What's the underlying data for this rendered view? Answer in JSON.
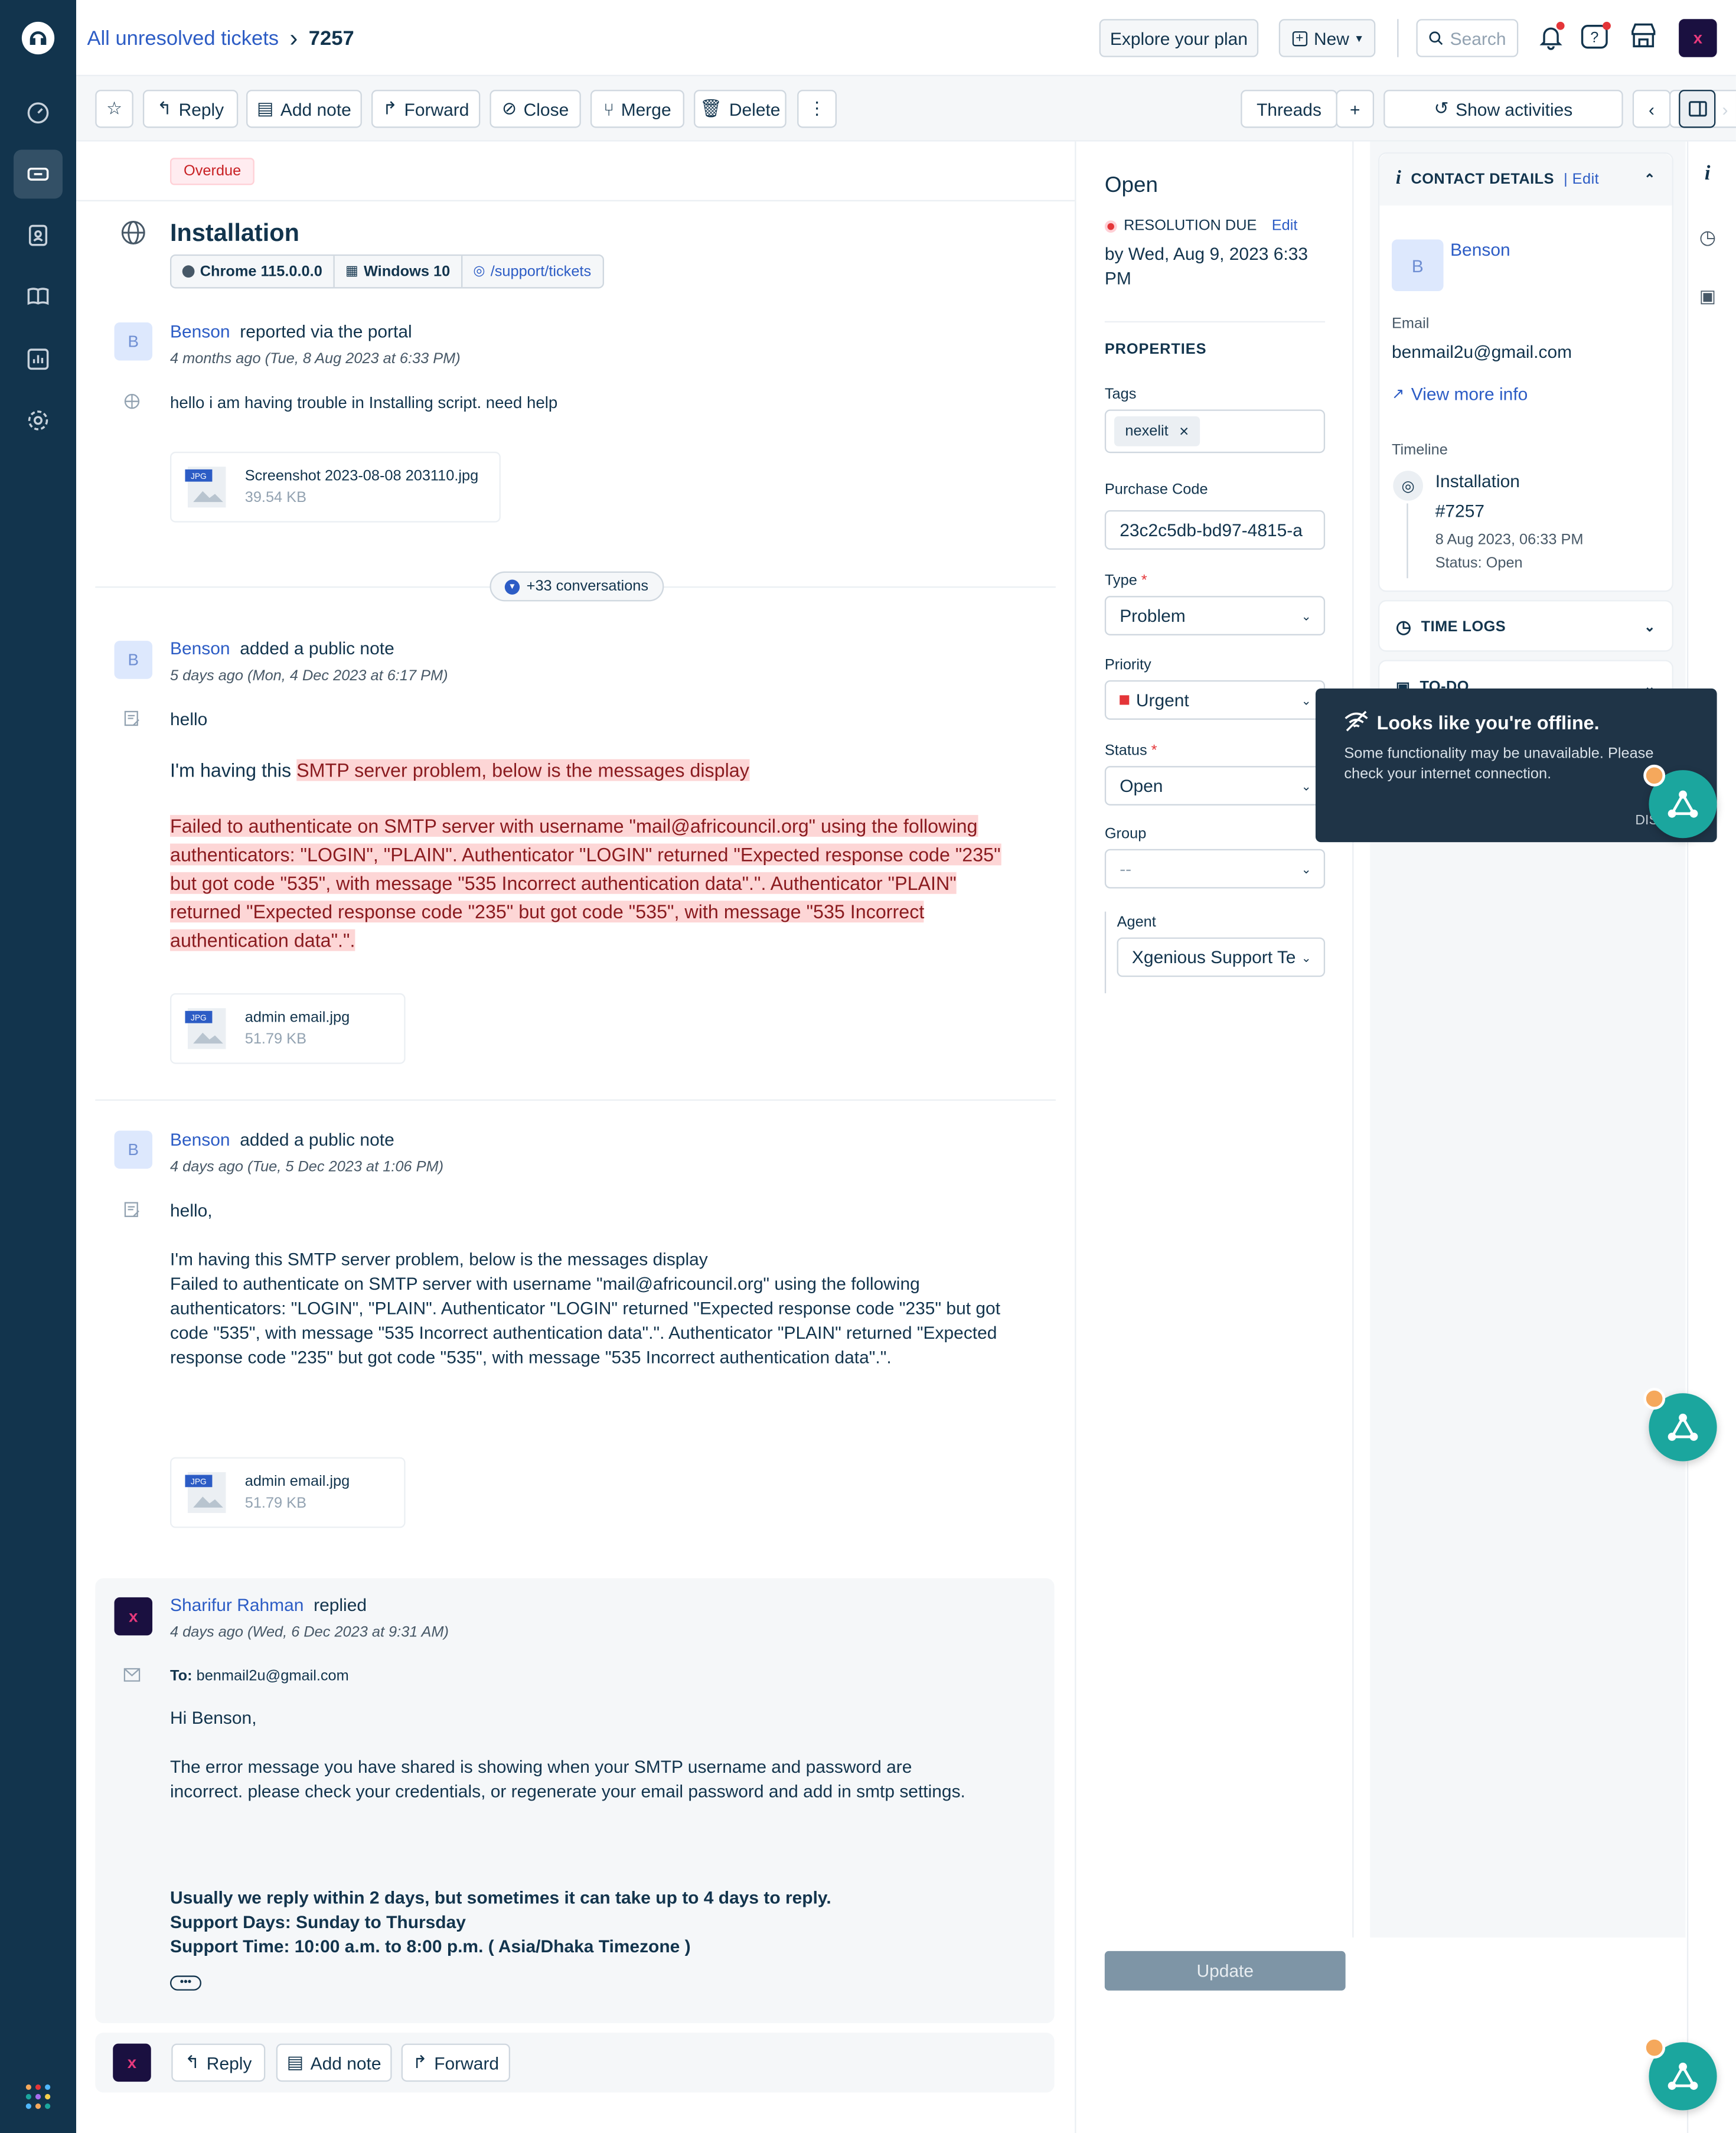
{
  "header": {
    "breadcrumb_parent": "All unresolved tickets",
    "breadcrumb_sep": "›",
    "ticket_id": "7257",
    "explore_plan": "Explore your plan",
    "new_label": "New",
    "search_placeholder": "Search"
  },
  "toolbar": {
    "reply": "Reply",
    "add_note": "Add note",
    "forward": "Forward",
    "close": "Close",
    "merge": "Merge",
    "delete": "Delete",
    "more": "⋮",
    "threads": "Threads",
    "plus": "+",
    "show_activities": "Show activities",
    "prev": "‹",
    "ellipsis": "···",
    "next": "›"
  },
  "ticket": {
    "overdue": "Overdue",
    "subject": "Installation",
    "browser": "Chrome 115.0.0.0",
    "os": "Windows 10",
    "url": "/support/tickets",
    "more_conversations": "+33 conversations"
  },
  "messages": [
    {
      "author": "Benson",
      "action": "reported via the portal",
      "time": "4 months ago (Tue, 8 Aug 2023 at 6:33 PM)",
      "body": "hello i am having trouble in Installing script. need help",
      "attachment": {
        "type": "JPG",
        "name": "Screenshot 2023-08-08 203110.jpg",
        "size": "39.54 KB"
      }
    },
    {
      "author": "Benson",
      "action": "added a public note",
      "time": "5 days ago (Mon, 4 Dec 2023 at 6:17 PM)",
      "line1": "hello",
      "line2_prefix": "I'm having this ",
      "line2_hl": "SMTP server problem,  below is the messages display ",
      "highlight_block": "Failed to authenticate on SMTP server with username \"mail@africouncil.org\" using the following authenticators: \"LOGIN\", \"PLAIN\". Authenticator \"LOGIN\" returned \"Expected response code \"235\" but got code \"535\", with message \"535 Incorrect authentication data\".\". Authenticator \"PLAIN\" returned \"Expected response code \"235\" but got code \"535\", with message \"535 Incorrect authentication data\".\".",
      "attachment": {
        "type": "JPG",
        "name": "admin email.jpg",
        "size": "51.79 KB"
      }
    },
    {
      "author": "Benson",
      "action": "added a public note",
      "time": "4 days ago (Tue, 5 Dec 2023 at 1:06 PM)",
      "line1": "hello,",
      "line2": "I'm having this SMTP server problem, below is the messages display",
      "body": "Failed to authenticate on SMTP server with username \"mail@africouncil.org\" using the following authenticators: \"LOGIN\", \"PLAIN\". Authenticator \"LOGIN\" returned \"Expected response code \"235\" but got code \"535\", with message \"535 Incorrect authentication data\".\". Authenticator \"PLAIN\" returned \"Expected response code \"235\" but got code \"535\", with message \"535 Incorrect authentication data\".\".",
      "attachment": {
        "type": "JPG",
        "name": "admin email.jpg",
        "size": "51.79 KB"
      }
    },
    {
      "author": "Sharifur Rahman",
      "action": "replied",
      "time": "4 days ago (Wed, 6 Dec 2023 at 9:31 AM)",
      "to_label": "To:",
      "to": "benmail2u@gmail.com",
      "greeting": "Hi Benson,",
      "para": "The error message you have shared is showing when your SMTP username and password are incorrect. please check your  credentials, or regenerate your email password and add in smtp settings.",
      "sig1": "Usually we reply within 2 days, but sometimes it can take up to 4 days to reply.",
      "sig2": "Support Days: Sunday to Thursday",
      "sig3": "Support Time: 10:00 a.m. to 8:00 p.m. ( Asia/Dhaka Timezone )",
      "expand": "•••"
    }
  ],
  "bottom_actions": {
    "reply": "Reply",
    "add_note": "Add note",
    "forward": "Forward"
  },
  "properties": {
    "status_title": "Open",
    "resolution_due": "RESOLUTION DUE",
    "edit": "Edit",
    "due_text": "by Wed, Aug 9, 2023 6:33 PM",
    "section": "PROPERTIES",
    "tags_label": "Tags",
    "tag": "nexelit",
    "purchase_code_label": "Purchase Code",
    "purchase_code": "23c2c5db-bd97-4815-a",
    "type_label": "Type",
    "type": "Problem",
    "priority_label": "Priority",
    "priority": "Urgent",
    "status_label": "Status",
    "status": "Open",
    "group_label": "Group",
    "group": "--",
    "agent_label": "Agent",
    "agent": "Xgenious Support Te",
    "update": "Update"
  },
  "contact": {
    "header": "CONTACT DETAILS",
    "edit": "Edit",
    "initial": "B",
    "name": "Benson",
    "email_label": "Email",
    "email": "benmail2u@gmail.com",
    "view_more": "View more info",
    "timeline_label": "Timeline",
    "tl_title": "Installation",
    "tl_id": "#7257",
    "tl_date": "8 Aug 2023, 06:33 PM",
    "tl_status": "Status: Open",
    "time_logs": "TIME LOGS",
    "todo": "TO-DO"
  },
  "toast": {
    "title": "Looks like you're offline.",
    "text": "Some functionality may be unavailable. Please check your internet connection.",
    "dismiss": "DIS"
  },
  "colors": {
    "nav": "#12344d",
    "link": "#2c5cc5",
    "danger": "#e43538",
    "teal": "#1ba69e"
  }
}
